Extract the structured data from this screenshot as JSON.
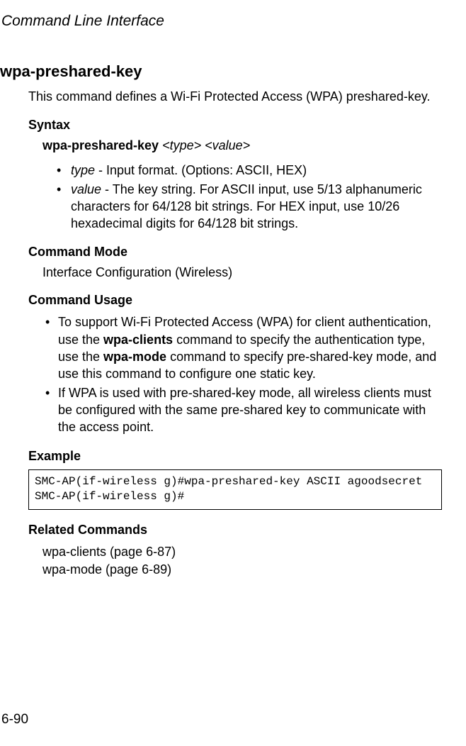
{
  "header": "Command Line Interface",
  "command": {
    "title": "wpa-preshared-key",
    "description": "This command defines a Wi-Fi Protected Access (WPA) preshared-key.",
    "syntax": {
      "heading": "Syntax",
      "keyword": "wpa-preshared-key",
      "args": "<type> <value>",
      "params": [
        {
          "name": "type",
          "desc": " - Input format. (Options: ASCII, HEX)"
        },
        {
          "name": "value",
          "desc": " - The key string. For ASCII input, use 5/13 alphanumeric characters for 64/128 bit strings. For HEX input, use 10/26 hexadecimal digits for 64/128 bit strings."
        }
      ]
    },
    "mode": {
      "heading": "Command Mode",
      "text": "Interface Configuration (Wireless)"
    },
    "usage": {
      "heading": "Command Usage",
      "items": [
        {
          "pre": "To support Wi-Fi Protected Access (WPA) for client authentication, use the ",
          "kw1": "wpa-clients",
          "mid": " command to specify the authentication type, use the ",
          "kw2": "wpa-mode",
          "post": " command to specify pre-shared-key mode, and use this command to configure one static key."
        },
        {
          "pre": "If WPA is used with pre-shared-key mode, all wireless clients must be configured with the same pre-shared key to communicate with the access point.",
          "kw1": "",
          "mid": "",
          "kw2": "",
          "post": ""
        }
      ]
    },
    "example": {
      "heading": "Example",
      "lines": "SMC-AP(if-wireless g)#wpa-preshared-key ASCII agoodsecret\nSMC-AP(if-wireless g)#"
    },
    "related": {
      "heading": "Related Commands",
      "items": [
        "wpa-clients (page 6-87)",
        "wpa-mode (page 6-89)"
      ]
    }
  },
  "page_number": "6-90"
}
